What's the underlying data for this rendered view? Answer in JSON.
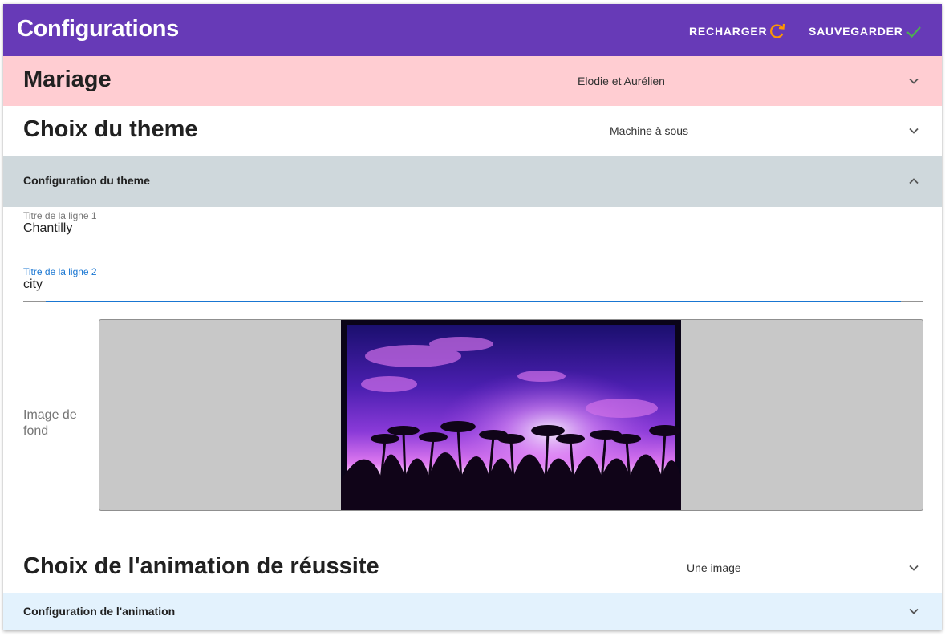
{
  "header": {
    "title": "Configurations",
    "reload_label": "RECHARGER",
    "save_label": "SAUVEGARDER",
    "reload_icon": "refresh-icon",
    "save_icon": "check-icon"
  },
  "panels": {
    "mariage": {
      "title": "Mariage",
      "value": "Elodie et Aurélien",
      "expanded": false
    },
    "theme": {
      "title": "Choix du theme",
      "value": "Machine à sous",
      "expanded": false
    },
    "theme_config": {
      "title": "Configuration du theme",
      "expanded": true
    },
    "animation": {
      "title": "Choix de l'animation de réussite",
      "value": "Une image",
      "expanded": false
    },
    "animation_config": {
      "title": "Configuration de l'animation",
      "expanded": false
    }
  },
  "fields": {
    "line1": {
      "label": "Titre de la ligne 1",
      "value": "Chantilly"
    },
    "line2": {
      "label": "Titre de la ligne 2",
      "value": "city"
    }
  },
  "background_image": {
    "label": "Image de fond"
  },
  "colors": {
    "toolbar": "#673ab7",
    "mariage_panel": "#ffcdd2",
    "theme_config_panel": "#cfd8dc",
    "animation_config_panel": "#e3f2fd",
    "focus": "#1976d2",
    "reload_icon": "#ff9800",
    "save_icon": "#4caf50"
  }
}
